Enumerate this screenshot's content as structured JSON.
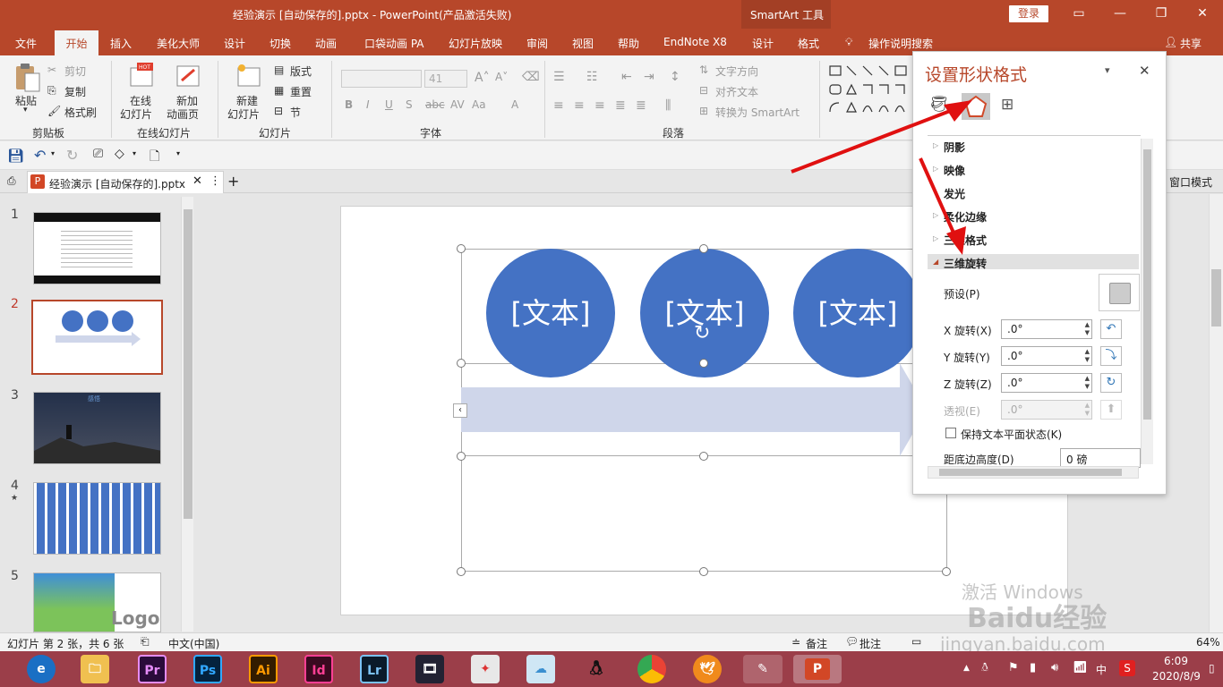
{
  "titlebar": {
    "title": "经验演示 [自动保存的].pptx  -  PowerPoint(产品激活失败)",
    "smartart_tools": "SmartArt 工具",
    "login": "登录"
  },
  "tabs": [
    "文件",
    "开始",
    "插入",
    "美化大师",
    "设计",
    "切换",
    "动画",
    "口袋动画 PA",
    "幻灯片放映",
    "审阅",
    "视图",
    "帮助",
    "EndNote X8",
    "设计",
    "格式"
  ],
  "tell_me": "操作说明搜索",
  "share": "共享",
  "ribbon": {
    "clipboard": {
      "label": "剪贴板",
      "paste": "粘贴",
      "cut": "剪切",
      "copy": "复制",
      "format_painter": "格式刷"
    },
    "online_slides": {
      "label": "在线幻灯片",
      "online": "在线",
      "online2": "幻灯片",
      "new_anim": "新加",
      "new_anim2": "动画页"
    },
    "slides": {
      "label": "幻灯片",
      "new_slide": "新建",
      "new_slide2": "幻灯片",
      "layout": "版式",
      "reset": "重置",
      "section": "节"
    },
    "font": {
      "label": "字体",
      "size": "41"
    },
    "paragraph": {
      "label": "段落",
      "text_direction": "文字方向",
      "align_text": "对齐文本",
      "convert_smartart": "转换为 SmartArt"
    }
  },
  "doc_tab": "经验演示 [自动保存的].pptx",
  "window_mode": "窗口模式",
  "thumbs": {
    "numbers": [
      "1",
      "2",
      "3",
      "4",
      "5"
    ],
    "star": "★",
    "slide3_title": "感悟",
    "slide5_logo": "Logo"
  },
  "slide": {
    "circle_texts": [
      "[文本]",
      "[文本]",
      "[文本]"
    ]
  },
  "format_pane": {
    "title": "设置形状格式",
    "sections": [
      "阴影",
      "映像",
      "发光",
      "柔化边缘",
      "三维格式",
      "三维旋转"
    ],
    "preset": "预设(P)",
    "x_rot": {
      "label": "X 旋转(X)",
      "value": ".0°"
    },
    "y_rot": {
      "label": "Y 旋转(Y)",
      "value": ".0°"
    },
    "z_rot": {
      "label": "Z 旋转(Z)",
      "value": ".0°"
    },
    "perspective": {
      "label": "透视(E)",
      "value": ".0°"
    },
    "keep_flat": "保持文本平面状态(K)",
    "distance": {
      "label": "距底边高度(D)",
      "value": "0 磅"
    }
  },
  "statusbar": {
    "slide_info": "幻灯片 第 2 张，共 6 张",
    "lang": "中文(中国)",
    "notes": "备注",
    "comments": "批注",
    "zoom": "64%"
  },
  "taskbar": {
    "apps": [
      "Pr",
      "Ps",
      "Ai",
      "Id",
      "Lr"
    ],
    "time": "6:09",
    "date": "2020/8/9",
    "ime": "中"
  },
  "watermark": {
    "line1": "激活 Windows",
    "brand": "Baidu经验",
    "url": "jingyan.baidu.com"
  },
  "colors": {
    "accent": "#b7472a",
    "circle": "#4472c4",
    "arrow": "#cfd6ea",
    "annotation": "#e01010"
  }
}
